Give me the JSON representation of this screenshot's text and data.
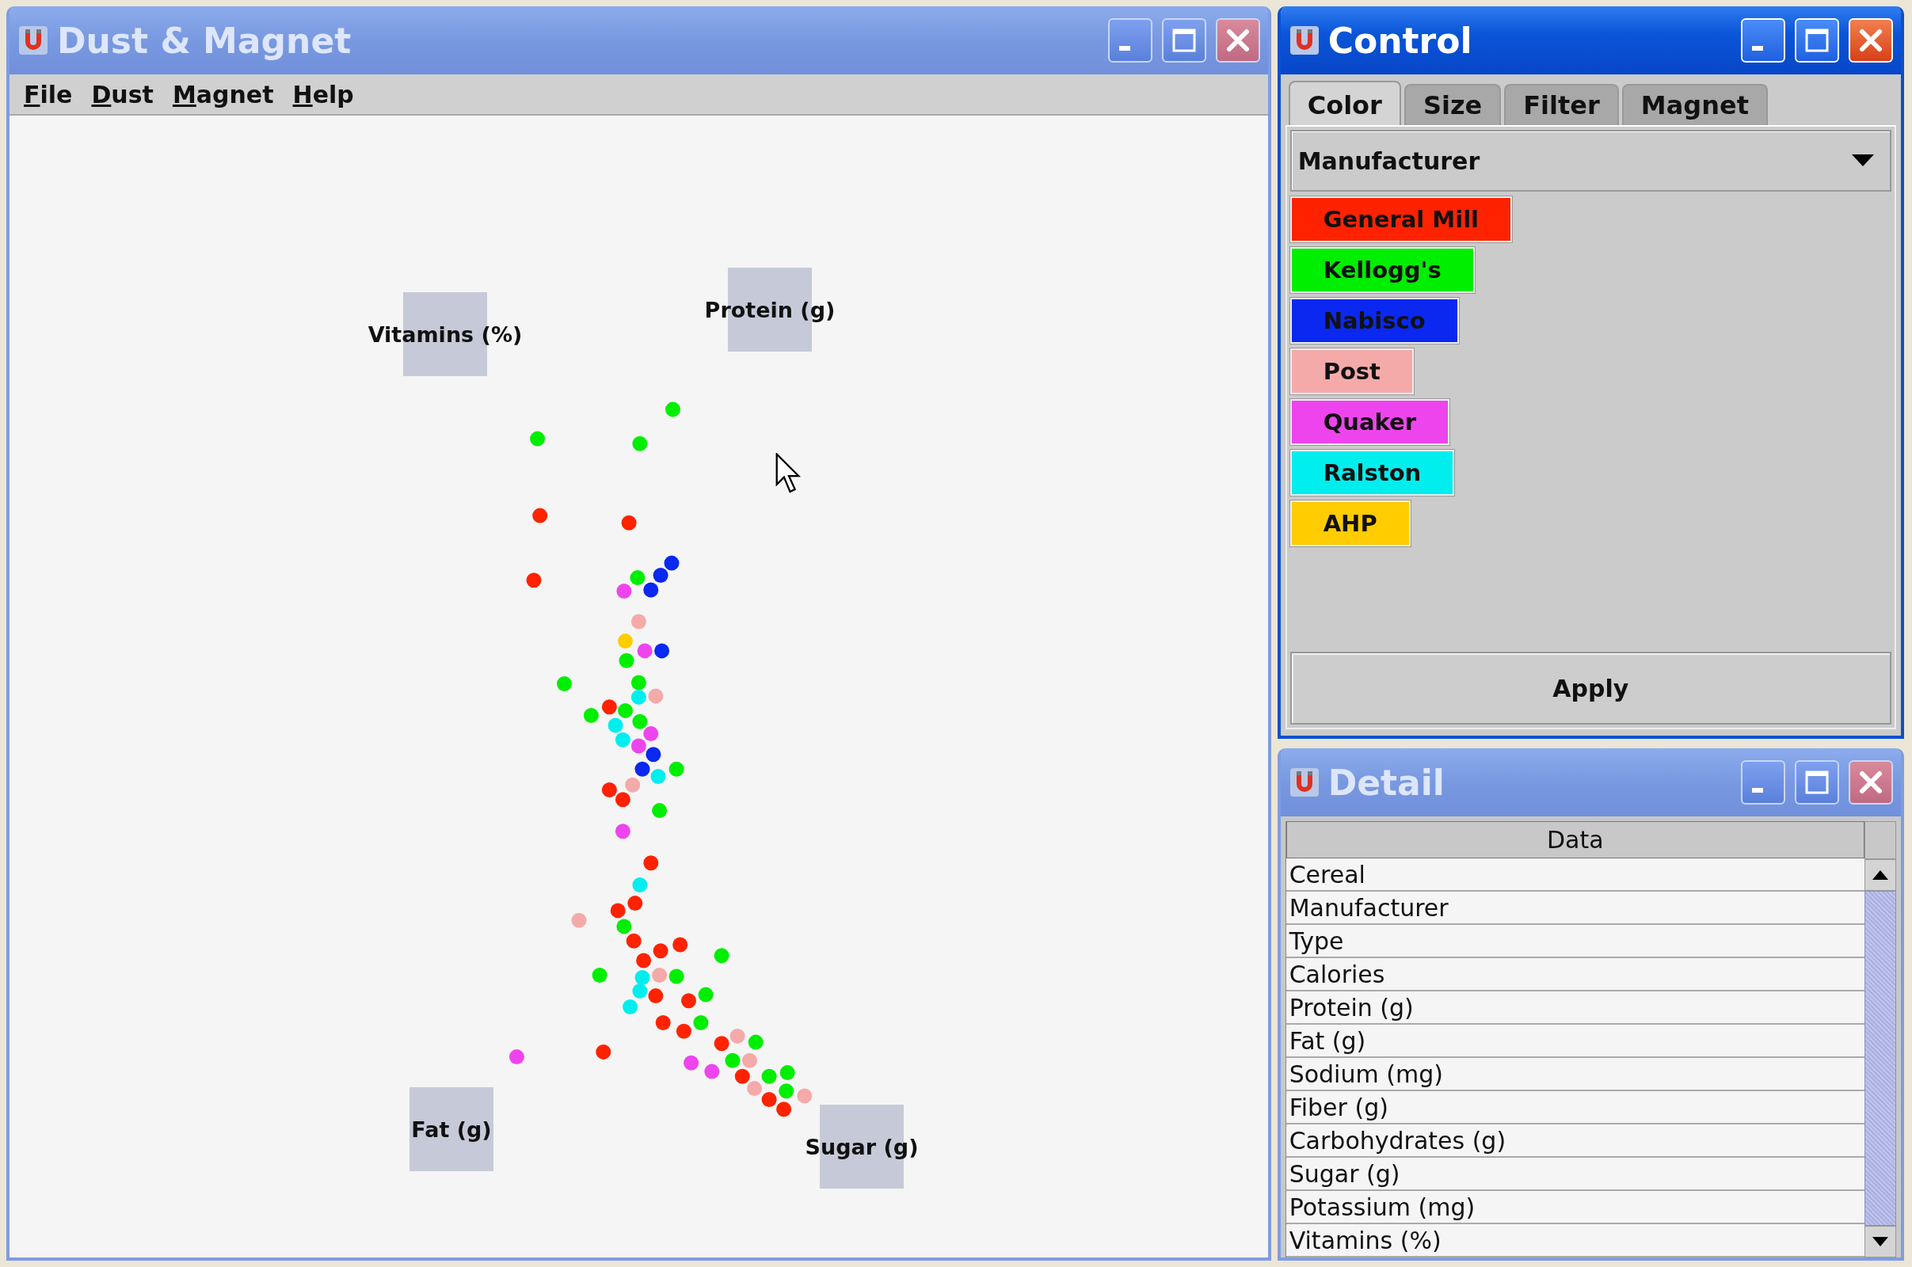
{
  "main_window": {
    "title": "Dust & Magnet",
    "active": false,
    "menu": [
      "File",
      "Dust",
      "Magnet",
      "Help"
    ],
    "magnets": [
      {
        "label": "Vitamins (%)"
      },
      {
        "label": "Protein (g)"
      },
      {
        "label": "Fat (g)"
      },
      {
        "label": "Sugar (g)"
      }
    ]
  },
  "control_window": {
    "title": "Control",
    "active": true,
    "tabs": [
      {
        "label": "Color",
        "selected": true
      },
      {
        "label": "Size",
        "selected": false
      },
      {
        "label": "Filter",
        "selected": false
      },
      {
        "label": "Magnet",
        "selected": false
      }
    ],
    "dropdown": {
      "value": "Manufacturer"
    },
    "legend": [
      {
        "label": "General Mill",
        "color": "#ff2200"
      },
      {
        "label": "Kellogg's",
        "color": "#00ee00"
      },
      {
        "label": "Nabisco",
        "color": "#0a28f0"
      },
      {
        "label": "Post",
        "color": "#f5aaaa"
      },
      {
        "label": "Quaker",
        "color": "#ee44ee"
      },
      {
        "label": "Ralston",
        "color": "#00eeee"
      },
      {
        "label": "AHP",
        "color": "#ffcc00"
      }
    ],
    "apply_button": "Apply"
  },
  "detail_window": {
    "title": "Detail",
    "active": false,
    "table": {
      "columns": [
        "Data"
      ],
      "rows": [
        "Cereal",
        "Manufacturer",
        "Type",
        "Calories",
        "Protein (g)",
        "Fat (g)",
        "Sodium (mg)",
        "Fiber (g)",
        "Carbohydrates (g)",
        "Sugar (g)",
        "Potassium (mg)",
        "Vitamins (%)"
      ]
    }
  }
}
